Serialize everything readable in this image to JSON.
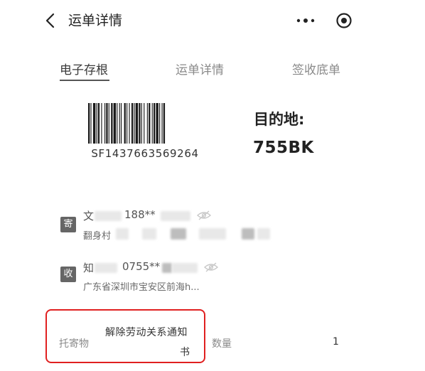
{
  "header": {
    "title": "运单详情",
    "back_icon": "chevron-left-icon",
    "more_icon": "more-dots-icon",
    "record_icon": "record-icon"
  },
  "tabs": [
    {
      "label": "电子存根",
      "active": true
    },
    {
      "label": "运单详情",
      "active": false
    },
    {
      "label": "签收底单",
      "active": false
    }
  ],
  "waybill": {
    "tracking_number": "SF1437663569264",
    "destination_label": "目的地:",
    "destination_code": "755BK"
  },
  "sender": {
    "badge": "寄",
    "name_partial": "文",
    "phone": "188**",
    "address_partial": "翻身村"
  },
  "receiver": {
    "badge": "收",
    "name_partial": "知",
    "phone": "0755**",
    "address": "广东省深圳市宝安区前海h..."
  },
  "cargo": {
    "label": "托寄物",
    "value_line1": "解除劳动关系通知",
    "value_line2": "书",
    "quantity_label": "数量",
    "quantity_value": "1"
  },
  "colors": {
    "highlight_border": "#e02020",
    "badge_bg": "#666666",
    "tab_active": "#3a3a3a",
    "tab_inactive": "#8a8a8a"
  }
}
